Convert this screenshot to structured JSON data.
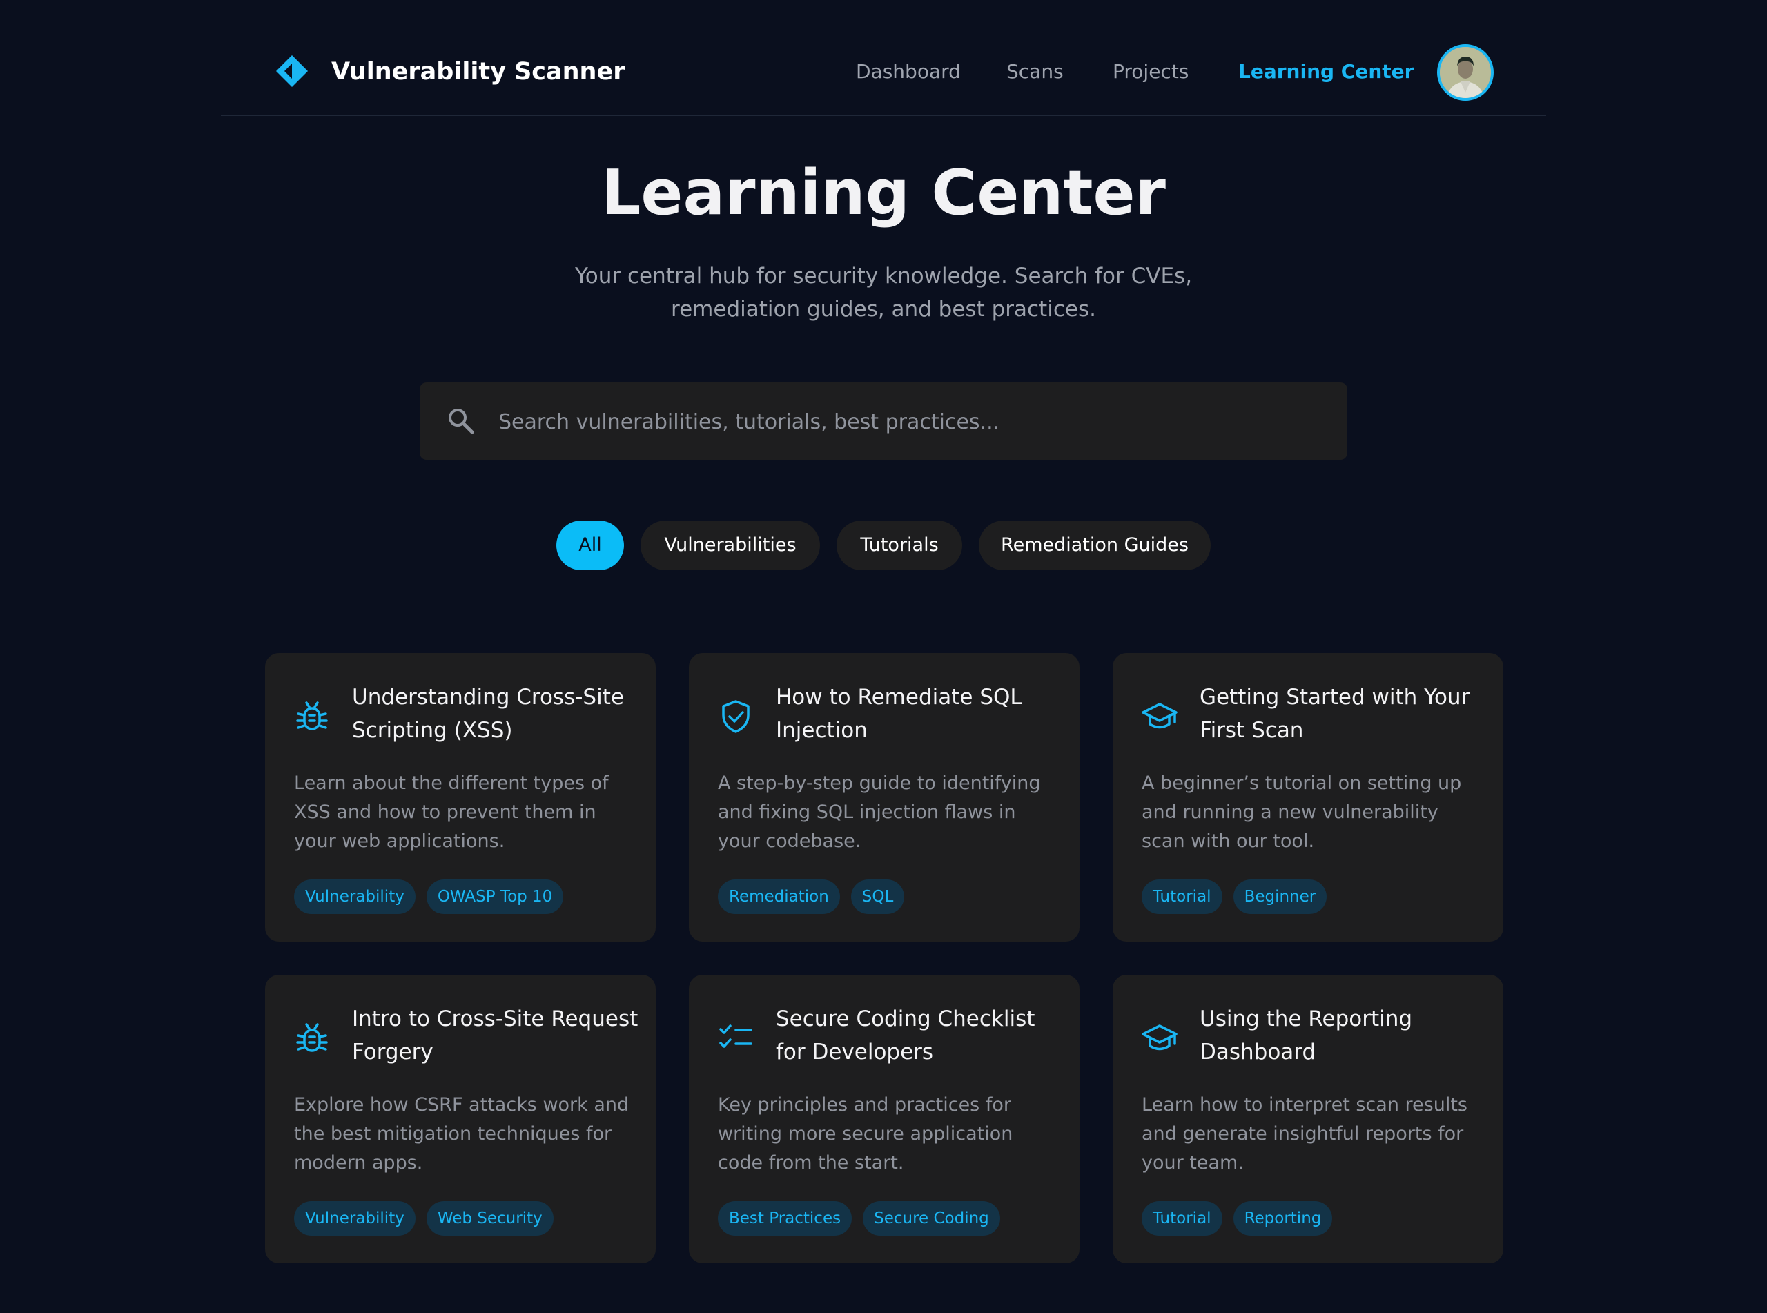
{
  "header": {
    "brand": "Vulnerability Scanner",
    "nav": [
      {
        "label": "Dashboard",
        "active": false
      },
      {
        "label": "Scans",
        "active": false
      },
      {
        "label": "Projects",
        "active": false
      },
      {
        "label": "Learning Center",
        "active": true
      }
    ],
    "avatar_icon": "user-avatar"
  },
  "page": {
    "title": "Learning Center",
    "subtitle_line1": "Your central hub for security knowledge. Search for CVEs,",
    "subtitle_line2": "remediation guides, and best practices."
  },
  "search": {
    "placeholder": "Search vulnerabilities, tutorials, best practices...",
    "value": "",
    "icon": "search-icon"
  },
  "filters": [
    {
      "label": "All",
      "active": true
    },
    {
      "label": "Vulnerabilities",
      "active": false
    },
    {
      "label": "Tutorials",
      "active": false
    },
    {
      "label": "Remediation Guides",
      "active": false
    }
  ],
  "cards": [
    {
      "icon": "bug-icon",
      "title": "Understanding Cross-Site Scripting (XSS)",
      "description": "Learn about the different types of XSS and how to prevent them in your web applications.",
      "tags": [
        "Vulnerability",
        "OWASP Top 10"
      ]
    },
    {
      "icon": "shield-check-icon",
      "title": "How to Remediate SQL Injection",
      "description": "A step-by-step guide to identifying and fixing SQL injection flaws in your codebase.",
      "tags": [
        "Remediation",
        "SQL"
      ]
    },
    {
      "icon": "graduation-cap-icon",
      "title": "Getting Started with Your First Scan",
      "description": "A beginner’s tutorial on setting up and running a new vulnerability scan with our tool.",
      "tags": [
        "Tutorial",
        "Beginner"
      ]
    },
    {
      "icon": "bug-icon",
      "title": "Intro to Cross-Site Request Forgery",
      "description": "Explore how CSRF attacks work and the best mitigation techniques for modern apps.",
      "tags": [
        "Vulnerability",
        "Web Security"
      ]
    },
    {
      "icon": "checklist-icon",
      "title": "Secure Coding Checklist for Developers",
      "description": "Key principles and practices for writing more secure application code from the start.",
      "tags": [
        "Best Practices",
        "Secure Coding"
      ]
    },
    {
      "icon": "graduation-cap-icon",
      "title": "Using the Reporting Dashboard",
      "description": "Learn how to interpret scan results and generate insightful reports for your team.",
      "tags": [
        "Tutorial",
        "Reporting"
      ]
    }
  ],
  "colors": {
    "background": "#0a0f1e",
    "accent": "#1ab6f3",
    "card": "#1e1e1f",
    "tag_bg": "#133347"
  }
}
